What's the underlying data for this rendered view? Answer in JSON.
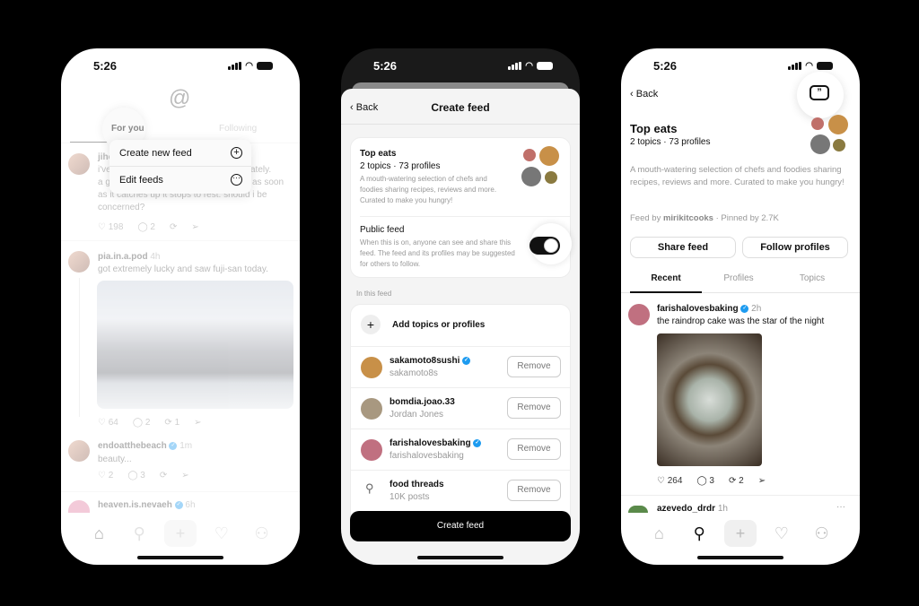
{
  "status_time": "5:26",
  "phone1": {
    "tabs": [
      "For you",
      "Following"
    ],
    "menu": [
      {
        "label": "Create new feed",
        "icon": "plus-circle-icon"
      },
      {
        "label": "Edit feeds",
        "icon": "more-circle-icon"
      }
    ],
    "posts": [
      {
        "user": "jiho",
        "lines": [
          "i've",
          "s lately.",
          "a g",
          "as soon",
          "as it catches up it stops to rest. should i be",
          "concerned?"
        ],
        "likes": "198",
        "replies": "2"
      },
      {
        "user": "pia.in.a.pod",
        "time": "4h",
        "text": "got extremely lucky and saw fuji-san today.",
        "likes": "64",
        "replies": "2",
        "reposts": "1"
      },
      {
        "user": "endoatthebeach",
        "time": "1m",
        "text": "beauty...",
        "likes": "2",
        "replies": "3"
      },
      {
        "user": "heaven.is.nevaeh",
        "time": "6h"
      }
    ]
  },
  "phone2": {
    "back": "Back",
    "title": "Create feed",
    "feed": {
      "name": "Top eats",
      "meta": "2 topics · 73 profiles",
      "desc": "A mouth-watering selection of chefs and foodies sharing recipes, reviews and more. Curated to make you hungry!"
    },
    "public": {
      "label": "Public feed",
      "desc": "When this is on, anyone can see and share this feed. The feed and its profiles may be suggested for others to follow.",
      "on": true
    },
    "section": "In this feed",
    "add": "Add topics or profiles",
    "items": [
      {
        "name": "sakamoto8sushi",
        "sub": "sakamoto8s",
        "verified": true
      },
      {
        "name": "bomdia.joao.33",
        "sub": "Jordan Jones",
        "verified": false
      },
      {
        "name": "farishalovesbaking",
        "sub": "farishalovesbaking",
        "verified": true
      },
      {
        "name": "food threads",
        "sub": "10K posts",
        "verified": false,
        "topic": true
      }
    ],
    "remove": "Remove",
    "create": "Create feed"
  },
  "phone3": {
    "back": "Back",
    "feed": {
      "name": "Top eats",
      "meta": "2 topics · 73 profiles",
      "desc": "A mouth-watering selection of chefs and foodies sharing recipes, reviews and more. Curated to make you hungry!",
      "by_prefix": "Feed by ",
      "by": "mirikitcooks",
      "pinned": " · Pinned by 2.7K"
    },
    "share": "Share feed",
    "follow": "Follow profiles",
    "tabs": [
      "Recent",
      "Profiles",
      "Topics"
    ],
    "post": {
      "user": "farishalovesbaking",
      "time": "2h",
      "text": "the raindrop cake was the star of the night",
      "likes": "264",
      "replies": "3",
      "reposts": "2"
    },
    "next": {
      "user": "azevedo_drdr",
      "time": "1h"
    }
  }
}
